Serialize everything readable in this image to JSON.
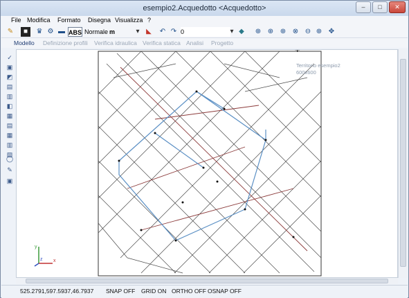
{
  "window": {
    "title": "esempio2.Acquedotto <Acquedotto>"
  },
  "window_buttons": {
    "minimize": "–",
    "maximize": "□",
    "close": "✕"
  },
  "menu": [
    "File",
    "Modifica",
    "Formato",
    "Disegna",
    "Visualizza",
    "?"
  ],
  "toolbar": {
    "abs_label": "ABS",
    "style_value": "Normale",
    "unit_value": "m",
    "layer_value": "0"
  },
  "tabs": [
    "Modello",
    "Definizione profili",
    "Verifica idraulica",
    "Verifica statica",
    "Analisi",
    "Progetto"
  ],
  "tooltip": {
    "line1": "Territorio esempio2",
    "line2": "600x600"
  },
  "axes": {
    "x": "x",
    "y": "y",
    "z": "z"
  },
  "status": {
    "coords": "525.2791,597.5937,46.7937",
    "snap": "SNAP OFF",
    "grid": "GRID ON",
    "ortho": "ORTHO OFF",
    "osnap": "OSNAP OFF"
  },
  "colors": {
    "accent": "#1f3c73",
    "pipe": "#5a8fc4",
    "close_button": "#c9473b"
  }
}
